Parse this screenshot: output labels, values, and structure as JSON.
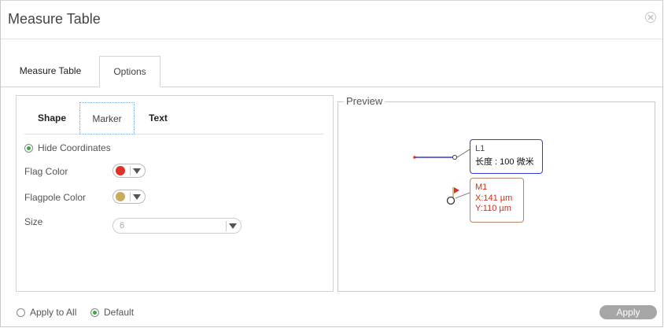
{
  "dialog": {
    "title": "Measure Table",
    "close_icon": "close-circle-icon"
  },
  "main_tabs": [
    {
      "label": "Measure Table",
      "active": false
    },
    {
      "label": "Options",
      "active": true
    }
  ],
  "sub_tabs": [
    {
      "label": "Shape",
      "active": false
    },
    {
      "label": "Marker",
      "active": true
    },
    {
      "label": "Text",
      "active": false
    }
  ],
  "marker_options": {
    "hide_coordinates": {
      "label": "Hide Coordinates",
      "checked": true
    },
    "flag_color": {
      "label": "Flag Color",
      "value": "#e0302a"
    },
    "flagpole_color": {
      "label": "Flagpole Color",
      "value": "#c9ab5e"
    },
    "size": {
      "label": "Size",
      "value": "6"
    }
  },
  "preview": {
    "legend": "Preview",
    "line_label": {
      "name": "L1",
      "text": "长度 : 100 微米",
      "color": "#2f3fd6"
    },
    "marker_label": {
      "name": "M1",
      "x_text": "X:141 µm",
      "y_text": "Y:110 µm",
      "color": "#d0301c"
    }
  },
  "footer": {
    "apply_to_all": {
      "label": "Apply to All",
      "checked": false
    },
    "default": {
      "label": "Default",
      "checked": true
    },
    "apply_button": "Apply"
  },
  "colors": {
    "accent_green": "#3aa844",
    "line_blue": "#2f3fd6",
    "marker_red": "#d0301c",
    "button_gray": "#a6a6a6"
  }
}
